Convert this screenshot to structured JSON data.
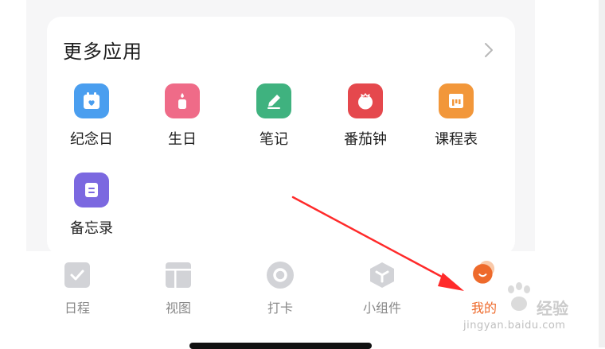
{
  "more_apps": {
    "title": "更多应用",
    "apps": [
      {
        "label": "纪念日",
        "icon": "calendar-heart-icon",
        "color": "#4a9eef"
      },
      {
        "label": "生日",
        "icon": "birthday-candle-icon",
        "color": "#ef6b88"
      },
      {
        "label": "笔记",
        "icon": "pencil-note-icon",
        "color": "#3fb27f"
      },
      {
        "label": "番茄钟",
        "icon": "tomato-timer-icon",
        "color": "#e5484d"
      },
      {
        "label": "课程表",
        "icon": "timetable-icon",
        "color": "#f2973a"
      },
      {
        "label": "备忘录",
        "icon": "memo-icon",
        "color": "#7b68e0"
      }
    ]
  },
  "tabbar": {
    "tabs": [
      {
        "label": "日程",
        "icon": "schedule-check-icon"
      },
      {
        "label": "视图",
        "icon": "view-layout-icon"
      },
      {
        "label": "打卡",
        "icon": "checkin-ring-icon"
      },
      {
        "label": "小组件",
        "icon": "widget-box-icon"
      },
      {
        "label": "我的",
        "icon": "profile-smile-icon",
        "active": true,
        "color": "#ee6a2b"
      }
    ]
  },
  "watermark": {
    "brand": "经验",
    "url": "jingyan.baidu.com"
  }
}
